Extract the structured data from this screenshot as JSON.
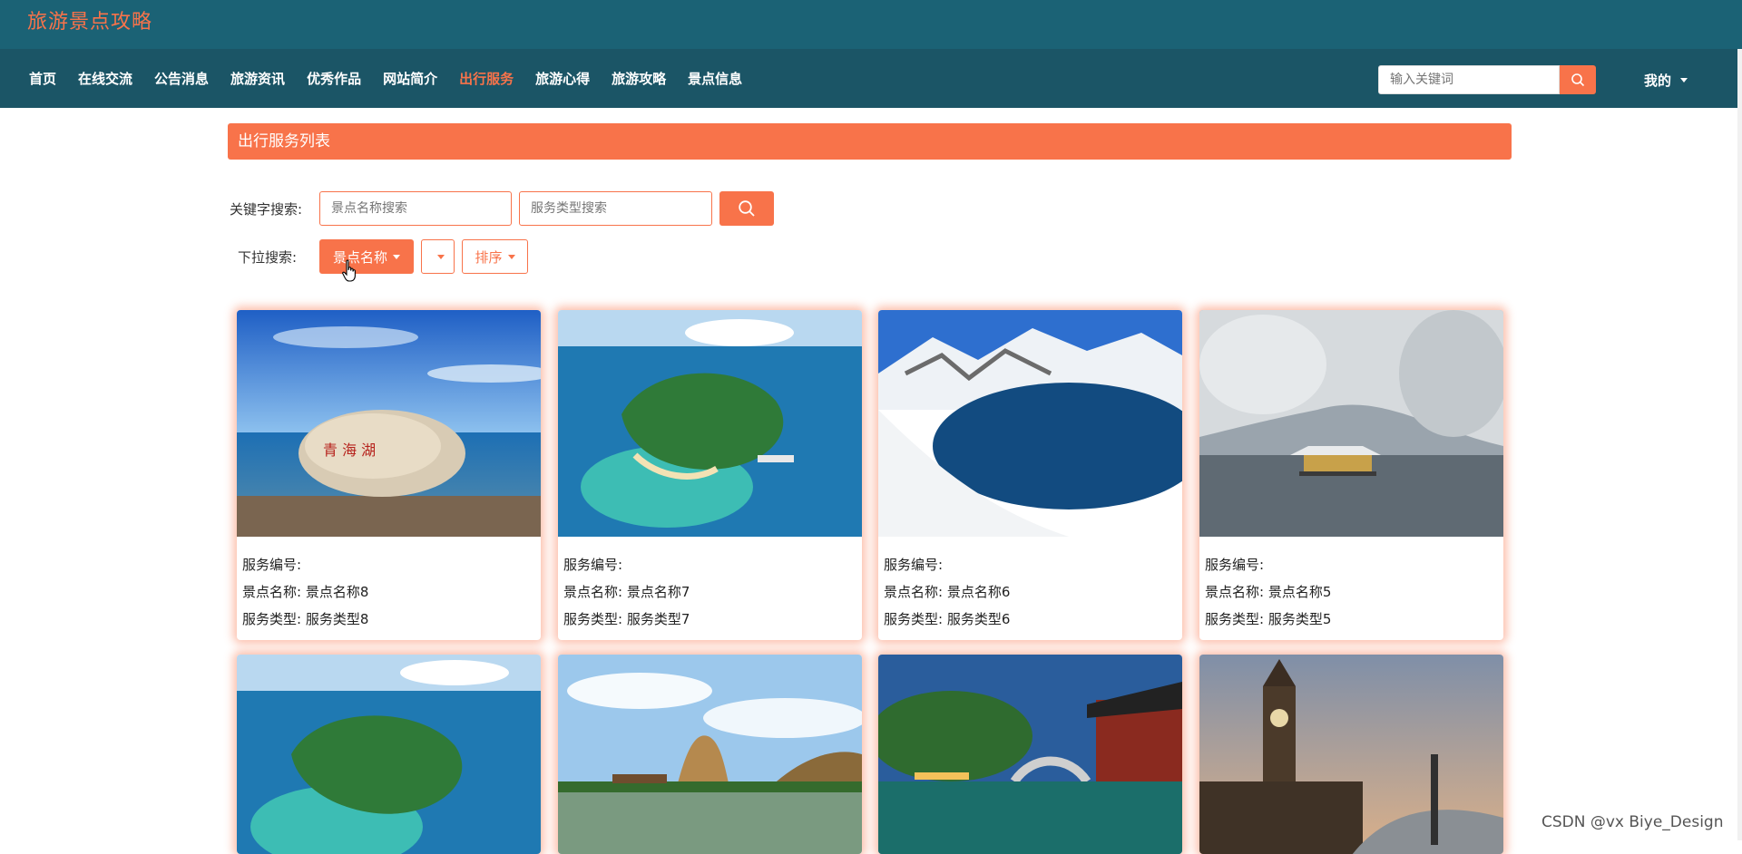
{
  "header": {
    "site_title": "旅游景点攻略"
  },
  "nav": {
    "items": [
      {
        "label": "首页",
        "active": false
      },
      {
        "label": "在线交流",
        "active": false
      },
      {
        "label": "公告消息",
        "active": false
      },
      {
        "label": "旅游资讯",
        "active": false
      },
      {
        "label": "优秀作品",
        "active": false
      },
      {
        "label": "网站简介",
        "active": false
      },
      {
        "label": "出行服务",
        "active": true
      },
      {
        "label": "旅游心得",
        "active": false
      },
      {
        "label": "旅游攻略",
        "active": false
      },
      {
        "label": "景点信息",
        "active": false
      }
    ],
    "search_placeholder": "输入关键词",
    "user_label": "我的"
  },
  "list": {
    "title": "出行服务列表",
    "keyword_label": "关键字搜索:",
    "name_placeholder": "景点名称搜索",
    "type_placeholder": "服务类型搜索",
    "dropdown_label": "下拉搜索:",
    "dropdown_name": "景点名称",
    "dropdown_empty": "",
    "sort_label": "排序"
  },
  "cards": [
    {
      "id_label": "服务编号:",
      "name_line": "景点名称: 景点名称8",
      "type_line": "服务类型: 服务类型8",
      "image": "beach-rock"
    },
    {
      "id_label": "服务编号:",
      "name_line": "景点名称: 景点名称7",
      "type_line": "服务类型: 服务类型7",
      "image": "island-aerial"
    },
    {
      "id_label": "服务编号:",
      "name_line": "景点名称: 景点名称6",
      "type_line": "服务类型: 服务类型6",
      "image": "snow-lake"
    },
    {
      "id_label": "服务编号:",
      "name_line": "景点名称: 景点名称5",
      "type_line": "服务类型: 服务类型5",
      "image": "snow-pavilion"
    },
    {
      "image": "island-aerial"
    },
    {
      "image": "karst-mountains"
    },
    {
      "image": "water-town"
    },
    {
      "image": "big-ben"
    }
  ],
  "watermark": "CSDN @vx  Biye_Design",
  "colors": {
    "accent": "#f8734a",
    "header_bg": "#1b6275",
    "nav_bg": "#1b5566"
  },
  "icons": [
    "search-icon",
    "caret-down-icon",
    "pointer-cursor-icon"
  ]
}
